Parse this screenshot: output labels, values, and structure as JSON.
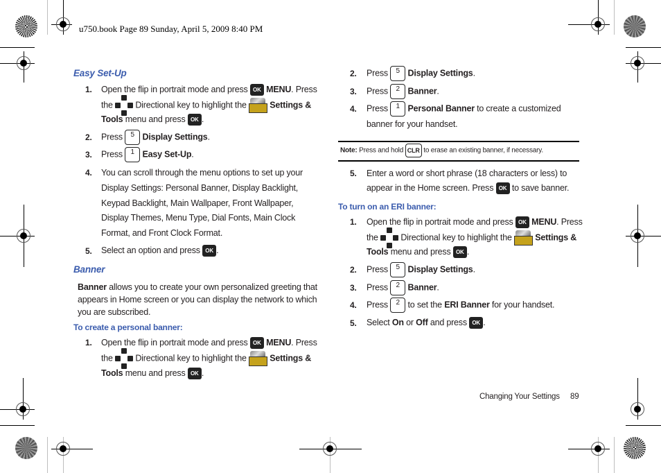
{
  "print_header": "u750.book  Page 89  Sunday, April 5, 2009  8:40 PM",
  "footer": {
    "section": "Changing Your Settings",
    "page_number": "89"
  },
  "icons": {
    "ok_key": "OK",
    "clr_key": "CLR",
    "directional_key": "directional-key-icon",
    "settings_tools": "settings-and-tools-icon"
  },
  "colors": {
    "heading_blue": "#3b5cad",
    "text": "#231f20",
    "ok_key_bg": "#222222",
    "tools_gold": "#c5a21c"
  },
  "left": {
    "easy_setup": {
      "heading": "Easy Set-Up",
      "steps": [
        {
          "n": "1.",
          "l1a": "Open the flip in portrait mode and press",
          "l1b": "MENU",
          "l1c": ". Press",
          "l2a": "the",
          "l2b": "Directional key to highlight the",
          "l2c": "Settings &",
          "l3a": "Tools",
          "l3b": "menu and press",
          "l3c": "."
        },
        {
          "n": "2.",
          "press": "Press",
          "key": "5",
          "bold": "Display Settings",
          "end": "."
        },
        {
          "n": "3.",
          "press": "Press",
          "key": "1",
          "bold": "Easy Set-Up",
          "end": "."
        },
        {
          "n": "4.",
          "lines": [
            "You can scroll through the menu options to set up your",
            "Display Settings: Personal Banner, Display Backlight,",
            "Keypad Backlight, Main Wallpaper, Front Wallpaper,",
            "Display Themes, Menu Type, Dial Fonts, Main Clock",
            "Format, and Front Clock Format."
          ]
        },
        {
          "n": "5.",
          "text": "Select an option and press",
          "end": "."
        }
      ]
    },
    "banner": {
      "heading": "Banner",
      "intro_bold": "Banner",
      "intro_l1": "allows you to create your own personalized greeting that",
      "intro_l2": "appears in Home screen or you can display the network to which",
      "intro_l3": "you are subscribed.",
      "subheading": "To create a personal banner:",
      "step1": {
        "n": "1.",
        "l1a": "Open the flip in portrait mode and press",
        "l1b": "MENU",
        "l1c": ". Press",
        "l2a": "the",
        "l2b": "Directional key to highlight the",
        "l2c": "Settings &",
        "l3a": "Tools",
        "l3b": "menu and press",
        "l3c": "."
      }
    }
  },
  "right": {
    "steps_cont": [
      {
        "n": "2.",
        "press": "Press",
        "key": "5",
        "bold": "Display Settings",
        "end": "."
      },
      {
        "n": "3.",
        "press": "Press",
        "key": "2",
        "bold": "Banner",
        "end": "."
      },
      {
        "n": "4.",
        "press": "Press",
        "key": "1",
        "bold": "Personal Banner",
        "end": " to create a customized",
        "l2": "banner for your handset."
      }
    ],
    "note": {
      "label": "Note:",
      "before": "Press and hold",
      "after": "to erase an existing banner, if necessary."
    },
    "step5": {
      "n": "5.",
      "l1": "Enter a word or short phrase (18 characters or less) to",
      "l2a": "appear in the Home screen. Press",
      "l2b": "to save banner."
    },
    "eri": {
      "subheading": "To turn on an ERI banner:",
      "step1": {
        "n": "1.",
        "l1a": "Open the flip in portrait mode and press",
        "l1b": "MENU",
        "l1c": ". Press",
        "l2a": "the",
        "l2b": "Directional key to highlight the",
        "l2c": "Settings &",
        "l3a": "Tools",
        "l3b": "menu and press",
        "l3c": "."
      },
      "step2": {
        "n": "2.",
        "press": "Press",
        "key": "5",
        "bold": "Display Settings",
        "end": "."
      },
      "step3": {
        "n": "3.",
        "press": "Press",
        "key": "2",
        "bold": "Banner",
        "end": "."
      },
      "step4": {
        "n": "4.",
        "press": "Press",
        "key": "2",
        "mid": "to set the",
        "bold": "ERI Banner",
        "end": "for your handset."
      },
      "step5": {
        "n": "5.",
        "a": "Select",
        "on": "On",
        "or": "or",
        "off": "Off",
        "b": "and press",
        "end": "."
      }
    }
  }
}
